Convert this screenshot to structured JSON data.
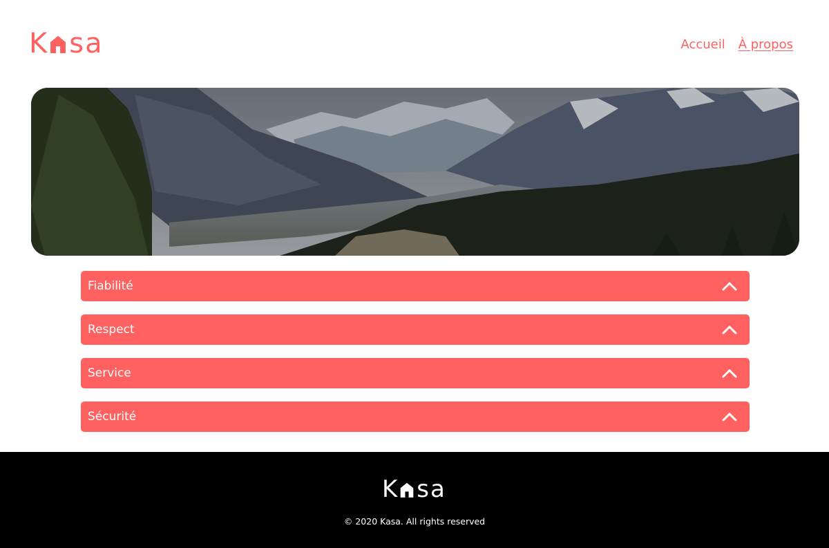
{
  "brand": {
    "logo_k": "K",
    "logo_rest": "sa",
    "accent_color": "#FF6060"
  },
  "nav": {
    "items": [
      {
        "label": "Accueil"
      },
      {
        "label": "À propos"
      }
    ]
  },
  "accordions": [
    {
      "title": "Fiabilité"
    },
    {
      "title": "Respect"
    },
    {
      "title": "Service"
    },
    {
      "title": "Sécurité"
    }
  ],
  "footer": {
    "logo_k": "K",
    "logo_rest": "sa",
    "copyright": "© 2020 Kasa. All rights reserved"
  },
  "icons": {
    "accordion_toggle": "chevron-up-icon",
    "logo_house": "house-icon"
  }
}
